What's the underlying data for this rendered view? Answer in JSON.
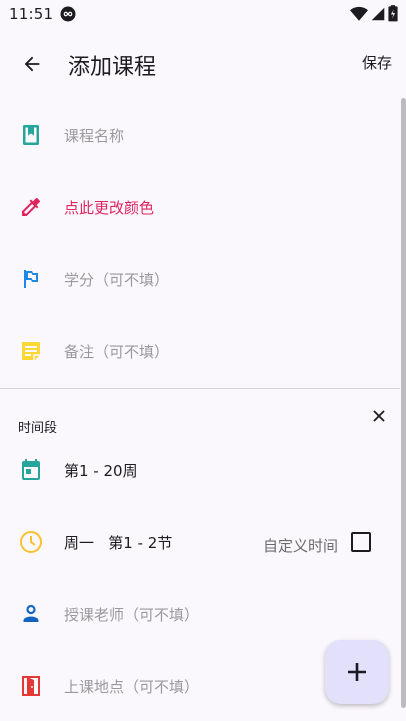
{
  "status_bar": {
    "time": "11:51"
  },
  "app_bar": {
    "title": "添加课程",
    "save_label": "保存"
  },
  "form": {
    "course_name_placeholder": "课程名称",
    "color_label": "点此更改颜色",
    "credit_placeholder": "学分（可不填）",
    "note_placeholder": "备注（可不填）"
  },
  "time_section": {
    "title": "时间段",
    "weeks": "第1 - 20周",
    "day_period": "周一   第1 - 2节",
    "custom_time_label": "自定义时间",
    "custom_time_checked": false,
    "teacher_placeholder": "授课老师（可不填）",
    "location_placeholder": "上课地点（可不填）"
  },
  "colors": {
    "teal": "#26a69a",
    "accent_red": "#e0245e",
    "blue": "#1e88e5",
    "yellow": "#fdd835",
    "orange": "#fbc02d",
    "teacher_blue": "#1565c0",
    "location_red": "#e53935",
    "fab_bg": "#e2e0fa"
  },
  "icons": {
    "course": "book-icon",
    "color": "eyedropper-icon",
    "credit": "flag-icon",
    "note": "note-icon",
    "weeks": "calendar-icon",
    "time": "clock-icon",
    "teacher": "person-icon",
    "location": "door-icon",
    "fab": "plus-icon"
  }
}
